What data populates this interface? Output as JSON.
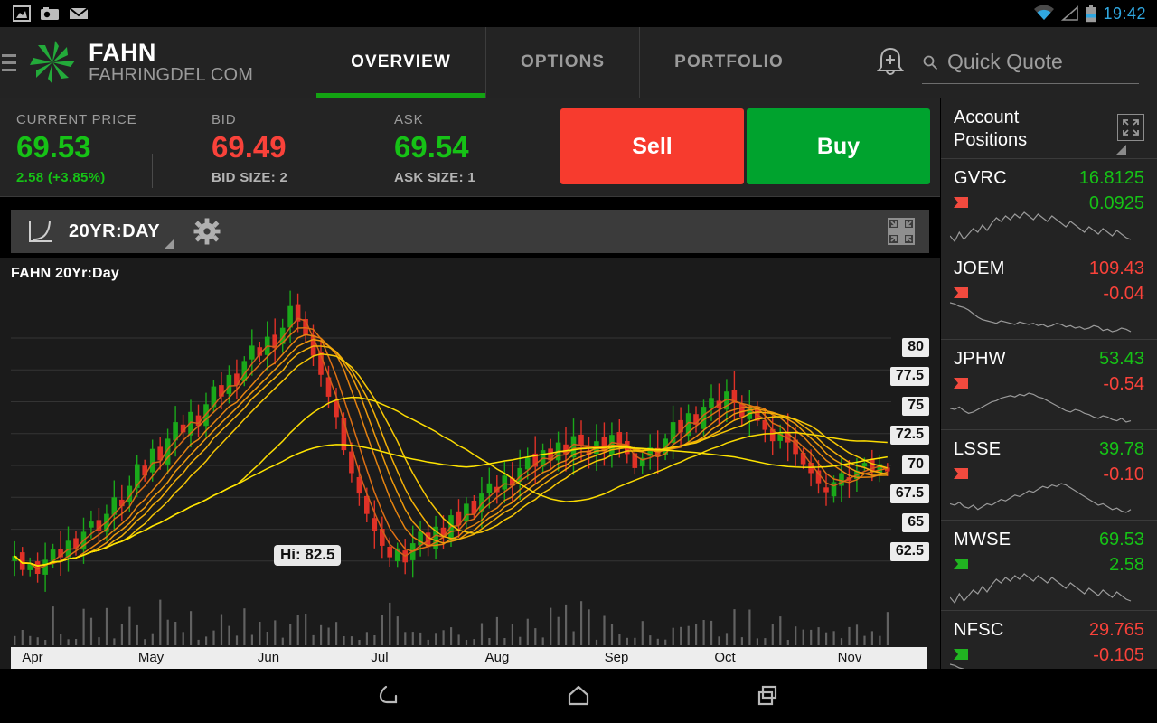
{
  "status_bar": {
    "icons": [
      "image-icon",
      "camera-icon",
      "mail-icon",
      "wifi-icon",
      "signal-icon",
      "battery-icon"
    ],
    "time": "19:42",
    "time_color": "#30a7e0"
  },
  "header": {
    "menu_icon": "hamburger-icon",
    "logo_icon": "fahn-starburst-logo",
    "symbol": "FAHN",
    "company": "FAHRINGDEL COM",
    "tabs": [
      {
        "label": "OVERVIEW",
        "active": true
      },
      {
        "label": "OPTIONS",
        "active": false
      },
      {
        "label": "PORTFOLIO",
        "active": false
      }
    ],
    "alert_icon": "bell-plus-icon",
    "search": {
      "icon": "search-icon",
      "placeholder": "Quick Quote",
      "value": ""
    },
    "accent_color": "#13a312"
  },
  "quote": {
    "current": {
      "label": "CURRENT PRICE",
      "value": "69.53",
      "change": "2.58 (+3.85%)",
      "direction": "up"
    },
    "bid": {
      "label": "BID",
      "value": "69.49",
      "size": "BID SIZE: 2",
      "direction": "down"
    },
    "ask": {
      "label": "ASK",
      "value": "69.54",
      "size": "ASK SIZE: 1",
      "direction": "up"
    },
    "sell_button": "Sell",
    "buy_button": "Buy",
    "sell_color": "#f73b2e",
    "buy_color": "#00a32e",
    "up_color": "#16c216",
    "down_color": "#f9423a"
  },
  "chart_toolbar": {
    "chart_type_icon": "line-chart-icon",
    "range_label": "20YR:DAY",
    "dropdown_icon": "caret-down-icon",
    "settings_icon": "gear-icon",
    "collapse_icon": "collapse-inward-icon"
  },
  "chart_data": {
    "type": "line",
    "title": "FAHN 20Yr:Day",
    "annotation": "Hi: 82.5",
    "xlabel": "",
    "ylabel": "",
    "ylim": [
      61.0,
      82.5
    ],
    "yticks": [
      "80",
      "77.5",
      "75",
      "72.5",
      "70",
      "67.5",
      "65",
      "62.5"
    ],
    "ytick_values": [
      80,
      77.5,
      75,
      72.5,
      70,
      67.5,
      65,
      62.5
    ],
    "categories": [
      "Apr",
      "May",
      "Jun",
      "Jul",
      "Aug",
      "Sep",
      "Oct",
      "Nov"
    ],
    "grid": true,
    "legend": "none",
    "series": [
      {
        "name": "price (candlesticks)",
        "type": "candlestick",
        "up_color": "#1aa81a",
        "down_color": "#e03127",
        "values": [
          62.9,
          61.8,
          62.3,
          61.5,
          62.6,
          63.4,
          62.8,
          64.1,
          63.5,
          64.8,
          65.6,
          64.9,
          66.2,
          67.5,
          66.8,
          68.4,
          70.1,
          69.2,
          71.3,
          70.4,
          72.1,
          73.4,
          72.6,
          74.2,
          73.1,
          74.8,
          76.2,
          75.4,
          77.1,
          76.3,
          78.2,
          79.4,
          78.6,
          80.1,
          79.2,
          80.8,
          82.5,
          81.3,
          80.2,
          78.6,
          77.1,
          75.4,
          73.8,
          71.2,
          69.4,
          67.8,
          66.2,
          64.9,
          63.7,
          62.8,
          63.5,
          62.4,
          63.9,
          64.8,
          63.6,
          65.2,
          64.4,
          66.1,
          65.3,
          67.0,
          66.2,
          67.8,
          68.6,
          67.9,
          69.2,
          68.4,
          69.8,
          70.6,
          69.9,
          71.2,
          70.4,
          71.8,
          70.9,
          72.3,
          71.5,
          70.8,
          71.9,
          71.1,
          72.4,
          71.6,
          70.9,
          69.8,
          70.6,
          71.4,
          70.7,
          72.1,
          73.4,
          72.6,
          74.1,
          73.2,
          74.6,
          75.3,
          74.5,
          75.8,
          74.9,
          73.8,
          74.6,
          73.5,
          72.8,
          71.9,
          72.6,
          71.8,
          70.9,
          70.1,
          69.4,
          68.6,
          67.9,
          68.7,
          69.4,
          68.8,
          69.6,
          70.2,
          69.5,
          70.1,
          69.53
        ]
      },
      {
        "name": "guppy MMA ribbon",
        "type": "moving-average-ribbon",
        "colors": [
          "#d2601a",
          "#dd7014",
          "#e68410",
          "#ee9a0c",
          "#f3b008",
          "#f7c704",
          "#fada02",
          "#ffe500"
        ],
        "periods": [
          3,
          5,
          8,
          10,
          12,
          15,
          30,
          60
        ]
      },
      {
        "name": "volume",
        "type": "bar",
        "color": "#6e6e6e"
      }
    ]
  },
  "sidebar": {
    "title": "Account\nPositions",
    "title_line1": "Account",
    "title_line2": "Positions",
    "expand_icon": "expand-outward-icon",
    "dropdown_icon": "caret-down-icon",
    "positions": [
      {
        "symbol": "GVRC",
        "last": "16.8125",
        "change": "0.0925",
        "last_dir": "up",
        "change_dir": "up",
        "flag": "red"
      },
      {
        "symbol": "JOEM",
        "last": "109.43",
        "change": "-0.04",
        "last_dir": "down",
        "change_dir": "down",
        "flag": "red"
      },
      {
        "symbol": "JPHW",
        "last": "53.43",
        "change": "-0.54",
        "last_dir": "up",
        "change_dir": "down",
        "flag": "red"
      },
      {
        "symbol": "LSSE",
        "last": "39.78",
        "change": "-0.10",
        "last_dir": "up",
        "change_dir": "down",
        "flag": "red"
      },
      {
        "symbol": "MWSE",
        "last": "69.53",
        "change": "2.58",
        "last_dir": "up",
        "change_dir": "up",
        "flag": "green"
      },
      {
        "symbol": "NFSC",
        "last": "29.765",
        "change": "-0.105",
        "last_dir": "down",
        "change_dir": "down",
        "flag": "green"
      }
    ]
  },
  "nav_bar": {
    "back_icon": "back-arrow-icon",
    "home_icon": "home-icon",
    "recents_icon": "recent-apps-icon"
  }
}
